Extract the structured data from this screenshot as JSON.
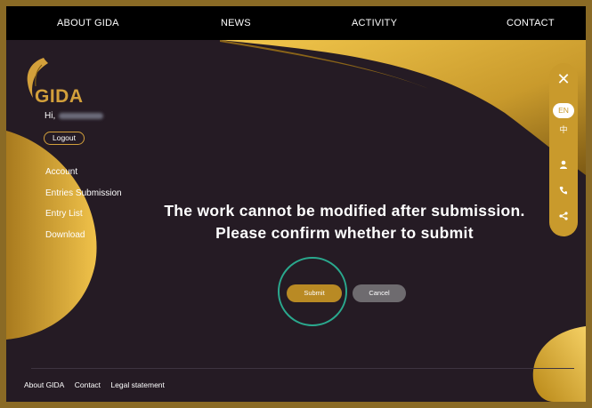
{
  "nav": {
    "about": "ABOUT GIDA",
    "news": "NEWS",
    "activity": "ACTIVITY",
    "contact": "CONTACT"
  },
  "brand": {
    "name": "GIDA"
  },
  "user": {
    "greeting": "Hi,"
  },
  "sidebar": {
    "logout": "Logout",
    "items": [
      {
        "label": "Account"
      },
      {
        "label": "Entries Submission"
      },
      {
        "label": "Entry List"
      },
      {
        "label": "Download"
      }
    ]
  },
  "dialog": {
    "line1": "The work cannot be modified after submission.",
    "line2": "Please confirm whether to submit",
    "submit": "Submit",
    "cancel": "Cancel"
  },
  "rightbar": {
    "close": "✕",
    "lang_en": "EN",
    "lang_zh": "中",
    "icons": [
      "user-icon",
      "phone-icon",
      "share-icon"
    ]
  },
  "footer": {
    "links": [
      "About GIDA",
      "Contact",
      "Legal statement"
    ]
  },
  "colors": {
    "gold": "#d3a03b",
    "background": "#251b24",
    "submit": "#b98a24",
    "cancel": "#6e6b6f",
    "highlight": "#2aa98e"
  }
}
